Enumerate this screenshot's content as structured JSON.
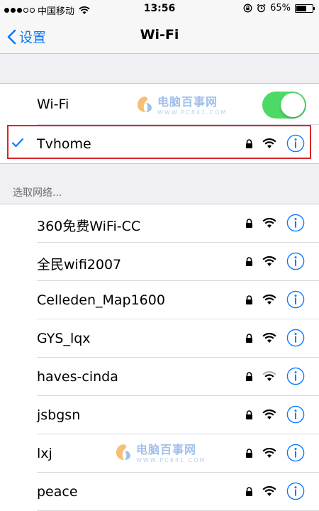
{
  "status_bar": {
    "carrier": "中国移动",
    "time": "13:56",
    "battery": "65%",
    "battery_level": 0.65
  },
  "nav": {
    "back_label": "设置",
    "title": "Wi-Fi"
  },
  "wifi_toggle": {
    "label": "Wi-Fi",
    "on": true
  },
  "connected": {
    "name": "Tvhome"
  },
  "section": {
    "header": "选取网络..."
  },
  "networks": [
    {
      "name": "360免费WiFi-CC"
    },
    {
      "name": "全民wifi2007"
    },
    {
      "name": "Celleden_Map1600"
    },
    {
      "name": "GYS_lqx"
    },
    {
      "name": "haves-cinda"
    },
    {
      "name": "jsbgsn"
    },
    {
      "name": "lxj"
    },
    {
      "name": "peace"
    }
  ],
  "watermark": {
    "text": "电脑百事网",
    "url": "WWW.PC841.COM"
  },
  "colors": {
    "accent": "#0a7aff",
    "toggle_on": "#4cd964",
    "highlight": "#d9262a"
  }
}
